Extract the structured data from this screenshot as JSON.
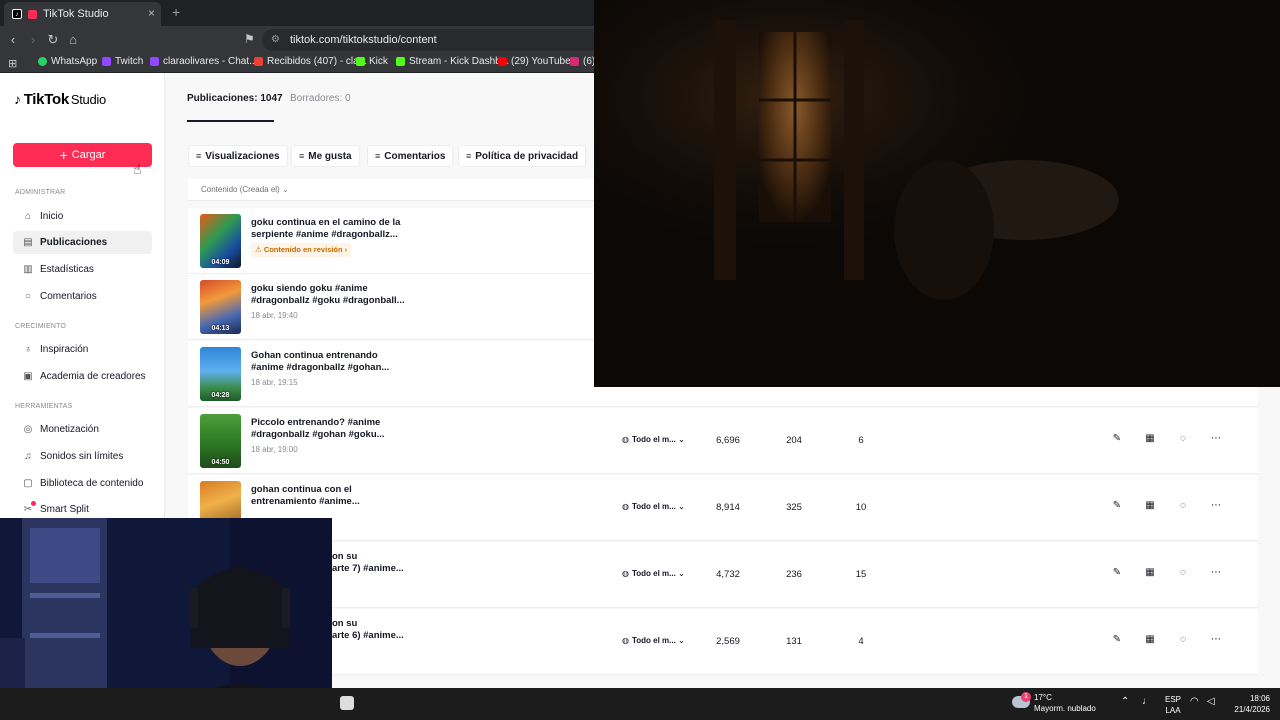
{
  "browser": {
    "tab_title": "TikTok Studio",
    "tab_close": "×",
    "new_tab": "+",
    "url": "tiktok.com/tiktokstudio/content",
    "bookmarks": [
      "WhatsApp",
      "Twitch",
      "claraolivares - Chat...",
      "Recibidos (407) - cla...",
      "Kick",
      "Stream - Kick Dashb...",
      "(29) YouTube",
      "(6)"
    ]
  },
  "sidebar": {
    "logo": "TikTok",
    "logo_suffix": "Studio",
    "upload_label": "Cargar",
    "sections": {
      "admin": "ADMINISTRAR",
      "growth": "CRECIMIENTO",
      "tools": "HERRAMIENTAS"
    },
    "items": [
      {
        "label": "Inicio",
        "icon": "home-icon"
      },
      {
        "label": "Publicaciones",
        "icon": "posts-icon"
      },
      {
        "label": "Estadísticas",
        "icon": "analytics-icon"
      },
      {
        "label": "Comentarios",
        "icon": "comments-icon"
      },
      {
        "label": "Inspiración",
        "icon": "lightbulb-icon"
      },
      {
        "label": "Academia de creadores",
        "icon": "academy-icon"
      },
      {
        "label": "Monetización",
        "icon": "money-icon"
      },
      {
        "label": "Sonidos sin límites",
        "icon": "music-icon"
      },
      {
        "label": "Biblioteca de contenido",
        "icon": "library-icon"
      },
      {
        "label": "Smart Split",
        "icon": "scissors-icon"
      }
    ]
  },
  "content": {
    "tabs": [
      "Publicaciones: 1047",
      "Borradores: 0"
    ],
    "filters": [
      "Visualizaciones",
      "Me gusta",
      "Comentarios",
      "Política de privacidad"
    ],
    "column_header": "Contenido (Creada el)",
    "rows": [
      {
        "title": "goku continua en el camino de la serpiente #anime #dragonballz...",
        "duration": "04:09",
        "date": "",
        "status": "Contenido en revisión",
        "privacy": "",
        "views": "",
        "likes": "",
        "comments": ""
      },
      {
        "title": "goku siendo goku #anime #dragonballz #goku #dragonball...",
        "duration": "04:13",
        "date": "18 abr, 19:40",
        "status": "",
        "privacy": "",
        "views": "",
        "likes": "",
        "comments": ""
      },
      {
        "title": "Gohan continua entrenando #anime #dragonballz #gohan...",
        "duration": "04:28",
        "date": "18 abr, 19:15",
        "status": "",
        "privacy": "",
        "views": "",
        "likes": "",
        "comments": ""
      },
      {
        "title": "Piccolo entrenando? #anime #dragonballz #gohan #goku...",
        "duration": "04:50",
        "date": "18 abr, 19:00",
        "status": "",
        "privacy": "Todo el m...",
        "views": "6,696",
        "likes": "204",
        "comments": "6"
      },
      {
        "title": "gohan continua con el entrenamiento #anime...",
        "duration": "",
        "date": "",
        "status": "",
        "privacy": "Todo el m...",
        "views": "8,914",
        "likes": "325",
        "comments": "10"
      },
      {
        "title": "on su\narte 7) #anime...",
        "duration": "",
        "date": "",
        "status": "",
        "privacy": "Todo el m...",
        "views": "4,732",
        "likes": "236",
        "comments": "15"
      },
      {
        "title": "on su\narte 6) #anime...",
        "duration": "",
        "date": "",
        "status": "",
        "privacy": "Todo el m...",
        "views": "2,569",
        "likes": "131",
        "comments": "4"
      }
    ]
  },
  "taskbar": {
    "weather_temp": "17°C",
    "weather_desc": "Mayorm. nublado",
    "weather_badge": "1",
    "lang_1": "ESP",
    "lang_2": "LAA",
    "time": "18:06",
    "date": "21/4/2026"
  }
}
